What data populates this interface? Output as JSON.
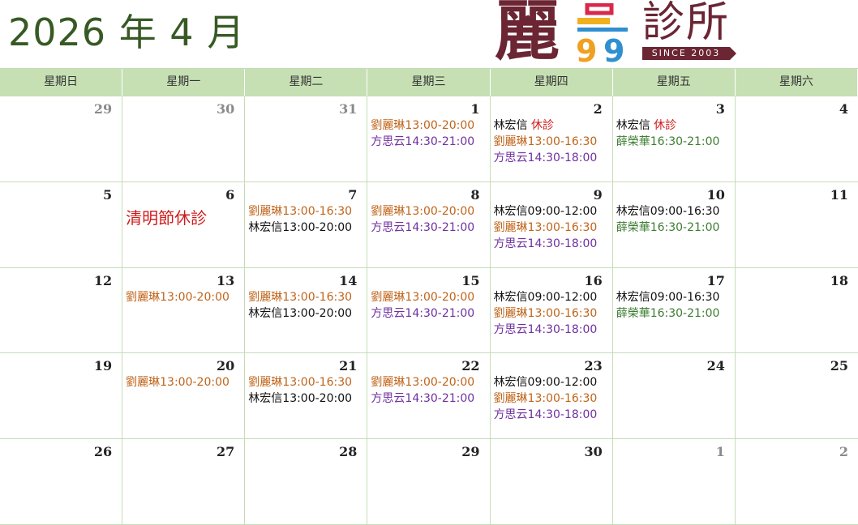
{
  "header": {
    "title": "2026 年 4 月",
    "logo_big": "麗",
    "logo_text": "診所",
    "logo_since": "SINCE 2003"
  },
  "colors": {
    "title": "#375a24",
    "logo": "#6b2533",
    "header_bg": "#c6e0b4",
    "grid_line": "#c6dcb8",
    "liu": "#c0641a",
    "fang": "#7030a0",
    "lin": "#111111",
    "xue": "#3e7d32",
    "off": "#d01b1b"
  },
  "weekdays": [
    "星期日",
    "星期一",
    "星期二",
    "星期三",
    "星期四",
    "星期五",
    "星期六"
  ],
  "weeks": [
    [
      {
        "day": "29",
        "muted": true,
        "entries": []
      },
      {
        "day": "30",
        "muted": true,
        "entries": []
      },
      {
        "day": "31",
        "muted": true,
        "entries": []
      },
      {
        "day": "1",
        "entries": [
          {
            "text": "劉麗琳13:00-20:00",
            "color": "#c0641a"
          },
          {
            "text": "方思云14:30-21:00",
            "color": "#7030a0"
          }
        ]
      },
      {
        "day": "2",
        "entries": [
          {
            "parts": [
              {
                "text": "林宏信 ",
                "color": "#111111"
              },
              {
                "text": "休診",
                "color": "#d01b1b"
              }
            ]
          },
          {
            "text": "劉麗琳13:00-16:30",
            "color": "#c0641a"
          },
          {
            "text": "方思云14:30-18:00",
            "color": "#7030a0"
          }
        ]
      },
      {
        "day": "3",
        "entries": [
          {
            "parts": [
              {
                "text": "林宏信 ",
                "color": "#111111"
              },
              {
                "text": "休診",
                "color": "#d01b1b"
              }
            ]
          },
          {
            "text": "薛榮華16:30-21:00",
            "color": "#3e7d32"
          }
        ]
      },
      {
        "day": "4",
        "entries": []
      }
    ],
    [
      {
        "day": "5",
        "entries": []
      },
      {
        "day": "6",
        "entries": [
          {
            "text": "清明節休診",
            "color": "#d01b1b",
            "big": true
          }
        ]
      },
      {
        "day": "7",
        "entries": [
          {
            "text": "劉麗琳13:00-16:30",
            "color": "#c0641a"
          },
          {
            "text": "林宏信13:00-20:00",
            "color": "#111111"
          }
        ]
      },
      {
        "day": "8",
        "entries": [
          {
            "text": "劉麗琳13:00-20:00",
            "color": "#c0641a"
          },
          {
            "text": "方思云14:30-21:00",
            "color": "#7030a0"
          }
        ]
      },
      {
        "day": "9",
        "entries": [
          {
            "text": "林宏信09:00-12:00",
            "color": "#111111"
          },
          {
            "text": "劉麗琳13:00-16:30",
            "color": "#c0641a"
          },
          {
            "text": "方思云14:30-18:00",
            "color": "#7030a0"
          }
        ]
      },
      {
        "day": "10",
        "entries": [
          {
            "text": "林宏信09:00-16:30",
            "color": "#111111"
          },
          {
            "text": "薛榮華16:30-21:00",
            "color": "#3e7d32"
          }
        ]
      },
      {
        "day": "11",
        "entries": []
      }
    ],
    [
      {
        "day": "12",
        "entries": []
      },
      {
        "day": "13",
        "entries": [
          {
            "text": "劉麗琳13:00-20:00",
            "color": "#c0641a"
          }
        ]
      },
      {
        "day": "14",
        "entries": [
          {
            "text": "劉麗琳13:00-16:30",
            "color": "#c0641a"
          },
          {
            "text": "林宏信13:00-20:00",
            "color": "#111111"
          }
        ]
      },
      {
        "day": "15",
        "entries": [
          {
            "text": "劉麗琳13:00-20:00",
            "color": "#c0641a"
          },
          {
            "text": "方思云14:30-21:00",
            "color": "#7030a0"
          }
        ]
      },
      {
        "day": "16",
        "entries": [
          {
            "text": "林宏信09:00-12:00",
            "color": "#111111"
          },
          {
            "text": "劉麗琳13:00-16:30",
            "color": "#c0641a"
          },
          {
            "text": "方思云14:30-18:00",
            "color": "#7030a0"
          }
        ]
      },
      {
        "day": "17",
        "entries": [
          {
            "text": "林宏信09:00-16:30",
            "color": "#111111"
          },
          {
            "text": "薛榮華16:30-21:00",
            "color": "#3e7d32"
          }
        ]
      },
      {
        "day": "18",
        "entries": []
      }
    ],
    [
      {
        "day": "19",
        "entries": []
      },
      {
        "day": "20",
        "entries": [
          {
            "text": "劉麗琳13:00-20:00",
            "color": "#c0641a"
          }
        ]
      },
      {
        "day": "21",
        "entries": [
          {
            "text": "劉麗琳13:00-16:30",
            "color": "#c0641a"
          },
          {
            "text": "林宏信13:00-20:00",
            "color": "#111111"
          }
        ]
      },
      {
        "day": "22",
        "entries": [
          {
            "text": "劉麗琳13:00-20:00",
            "color": "#c0641a"
          },
          {
            "text": "方思云14:30-21:00",
            "color": "#7030a0"
          }
        ]
      },
      {
        "day": "23",
        "entries": [
          {
            "text": "林宏信09:00-12:00",
            "color": "#111111"
          },
          {
            "text": "劉麗琳13:00-16:30",
            "color": "#c0641a"
          },
          {
            "text": "方思云14:30-18:00",
            "color": "#7030a0"
          }
        ]
      },
      {
        "day": "24",
        "entries": []
      },
      {
        "day": "25",
        "entries": []
      }
    ],
    [
      {
        "day": "26",
        "entries": []
      },
      {
        "day": "27",
        "entries": []
      },
      {
        "day": "28",
        "entries": []
      },
      {
        "day": "29",
        "entries": []
      },
      {
        "day": "30",
        "entries": []
      },
      {
        "day": "1",
        "muted": true,
        "entries": []
      },
      {
        "day": "2",
        "muted": true,
        "entries": []
      }
    ]
  ]
}
